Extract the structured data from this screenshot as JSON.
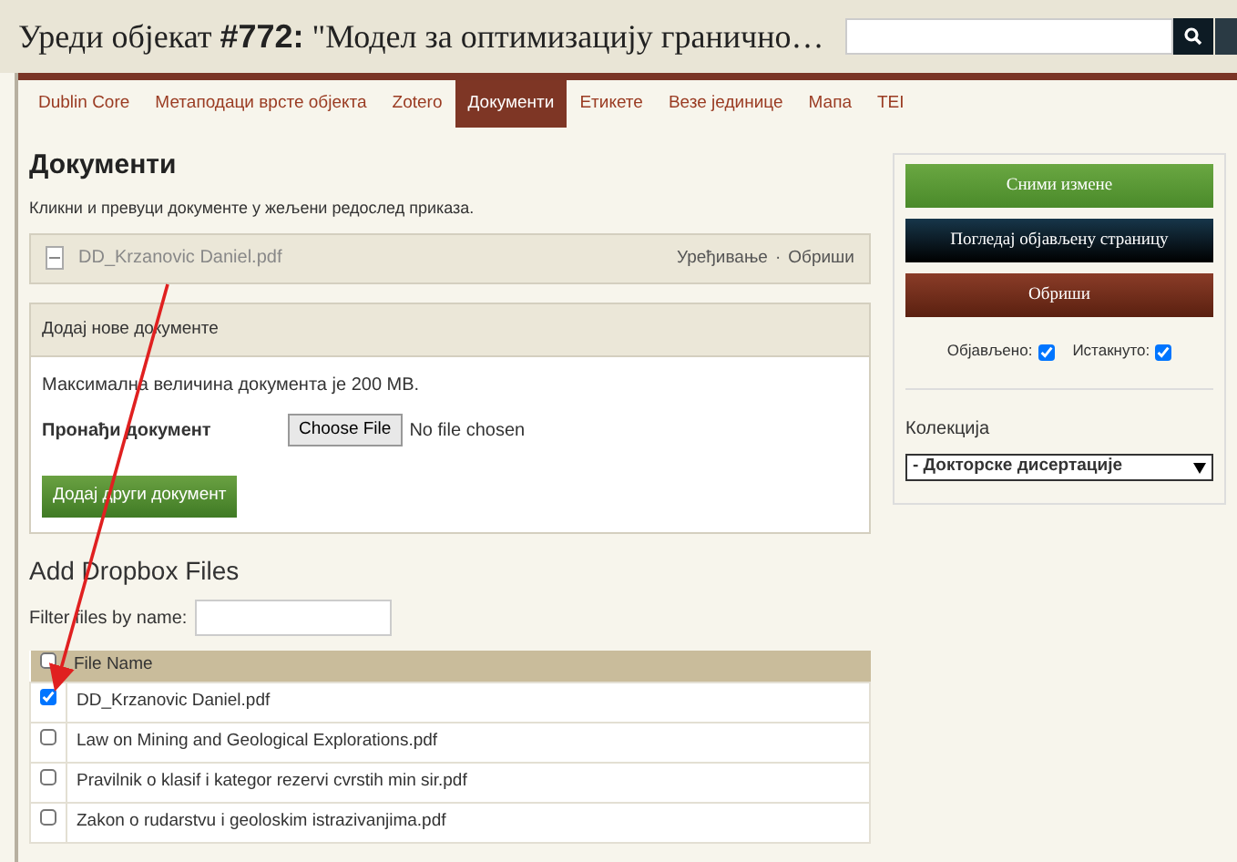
{
  "page_title": {
    "prefix": "Уреди објекат ",
    "number": "#772:",
    "rest": " \"Модел за оптимизацију гранично…"
  },
  "tabs": [
    {
      "label": "Dublin Core",
      "selected": false
    },
    {
      "label": "Метаподаци врсте објекта",
      "selected": false
    },
    {
      "label": "Zotero",
      "selected": false
    },
    {
      "label": "Документи",
      "selected": true
    },
    {
      "label": "Етикете",
      "selected": false
    },
    {
      "label": "Везе јединице",
      "selected": false
    },
    {
      "label": "Мапа",
      "selected": false
    },
    {
      "label": "TEI",
      "selected": false
    }
  ],
  "documents": {
    "heading": "Документи",
    "instructions": "Кликни и превуци документе у жељени редослед приказа.",
    "files": [
      {
        "name": "DD_Krzanovic Daniel.pdf",
        "edit": "Уређивање",
        "separator": "·",
        "delete": "Обриши"
      }
    ],
    "add_panel": {
      "title": "Додај нове документе",
      "max_size": "Максимална величина документа је 200 MB.",
      "find_label": "Пронађи документ",
      "choose_button": "Choose File",
      "no_file": "No file chosen",
      "add_button": "Додај други документ"
    }
  },
  "dropbox": {
    "heading": "Add Dropbox Files",
    "filter_label": "Filter files by name:",
    "header_checked": false,
    "column": "File Name",
    "rows": [
      {
        "name": "DD_Krzanovic Daniel.pdf",
        "checked": true
      },
      {
        "name": "Law on Mining and Geological Explorations.pdf",
        "checked": false
      },
      {
        "name": "Pravilnik o klasif i kategor rezervi cvrstih min sir.pdf",
        "checked": false
      },
      {
        "name": "Zakon o rudarstvu i geoloskim istrazivanjima.pdf",
        "checked": false
      }
    ]
  },
  "sidebar": {
    "buttons": [
      {
        "label": "Сними измене",
        "kind": "save"
      },
      {
        "label": "Погледај објављену страницу",
        "kind": "view"
      },
      {
        "label": "Обриши",
        "kind": "delete"
      }
    ],
    "flags": [
      {
        "label": "Објављено:",
        "checked": true
      },
      {
        "label": "Истакнуто:",
        "checked": true
      }
    ],
    "collection_label": "Колекција",
    "collection_value": "- Докторске дисертације"
  }
}
